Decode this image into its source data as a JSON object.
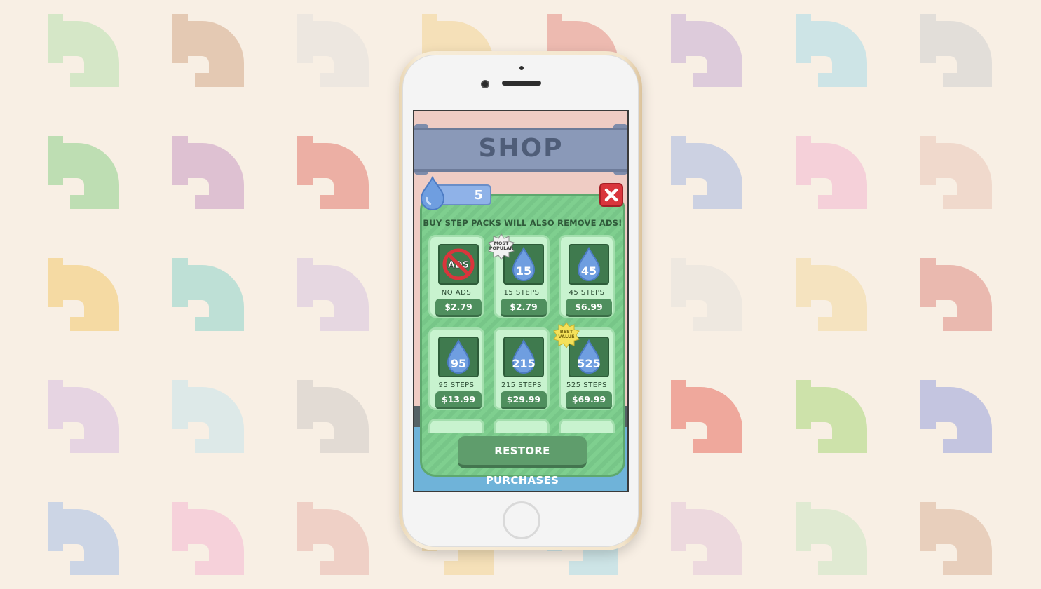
{
  "screen": {
    "title": "SHOP",
    "steps_balance": "5",
    "notice": "BUY STEP PACKS WILL ALSO REMOVE ADS!",
    "ads_icon_text": "ADS",
    "restore_label": "RESTORE PURCHASES",
    "products": [
      {
        "label": "NO ADS",
        "price": "$2.79",
        "icon": "no-ads-icon"
      },
      {
        "label": "15 STEPS",
        "price": "$2.79",
        "drop": "15",
        "badge": "MOST POPULAR",
        "badge_line1": "MOST",
        "badge_line2": "POPULAR"
      },
      {
        "label": "45 STEPS",
        "price": "$6.99",
        "drop": "45"
      },
      {
        "label": "95 STEPS",
        "price": "$13.99",
        "drop": "95"
      },
      {
        "label": "215 STEPS",
        "price": "$29.99",
        "drop": "215"
      },
      {
        "label": "525 STEPS",
        "price": "$69.99",
        "drop": "525",
        "badge": "BEST VALUE",
        "badge_line1": "BEST",
        "badge_line2": "VALUE"
      }
    ]
  },
  "colors": {
    "background": "#f8efe4",
    "panel": "#7fcf8f",
    "card": "#c8f3cf",
    "price_button": "#4f8f5e",
    "close_button": "#d9353c",
    "shop_bar": "#8a99b8",
    "drop": "#5a8fd8"
  }
}
